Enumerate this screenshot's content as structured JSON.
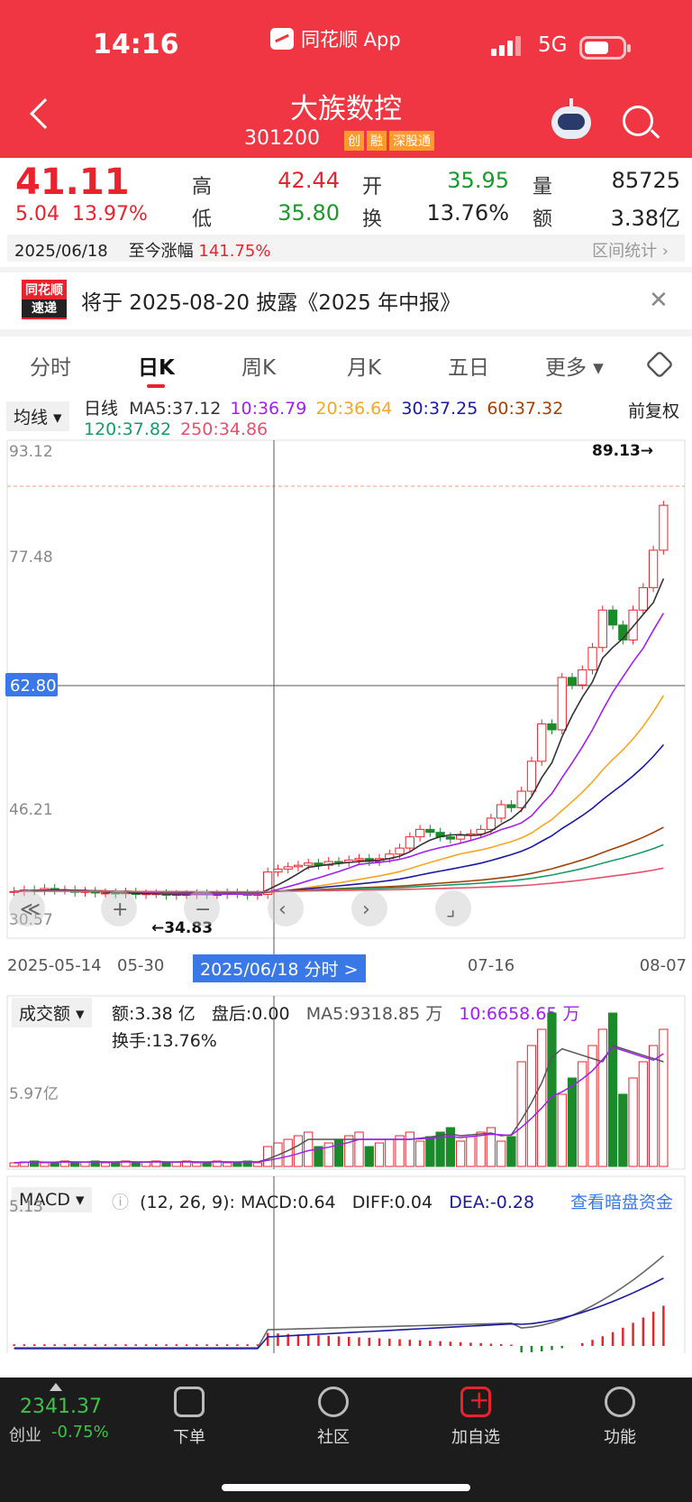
{
  "status": {
    "time": "14:16",
    "app": "同花顺 App",
    "network": "5G"
  },
  "stock": {
    "name": "大族数控",
    "code": "301200",
    "tags": [
      "创",
      "融",
      "深股通"
    ]
  },
  "quote": {
    "price": "41.11",
    "change": "5.04",
    "change_pct": "13.97%",
    "high_label": "高",
    "high": "42.44",
    "low_label": "低",
    "low": "35.80",
    "open_label": "开",
    "open": "35.95",
    "turnover_label": "换",
    "turnover": "13.76%",
    "volume_label": "量",
    "volume": "85725",
    "amount_label": "额",
    "amount": "3.38亿",
    "date": "2025/06/18",
    "since_label": "至今涨幅",
    "since_gain": "141.75%",
    "range_stat": "区间统计"
  },
  "notice": {
    "logo_top": "同花顺",
    "logo_bottom": "速递",
    "text": "将于 2025-08-20 披露《2025 年中报》"
  },
  "tabs": [
    "分时",
    "日K",
    "周K",
    "月K",
    "五日",
    "更多"
  ],
  "kline": {
    "indicator_select": "均线",
    "period": "日线",
    "adjust": "前复权",
    "ma": [
      {
        "label": "MA5:37.12",
        "color": "#333333"
      },
      {
        "label": "10:36.79",
        "color": "#a020f0"
      },
      {
        "label": "20:36.64",
        "color": "#f5a623"
      },
      {
        "label": "30:37.25",
        "color": "#1a1aa0"
      },
      {
        "label": "60:37.32",
        "color": "#a0420a"
      },
      {
        "label": "120:37.82",
        "color": "#1a9a6a"
      },
      {
        "label": "250:34.86",
        "color": "#e8506a"
      }
    ],
    "y_ticks": [
      "93.12",
      "77.48",
      "62.80",
      "46.21",
      "30.57"
    ],
    "crosshair_price": "62.80",
    "high_mark": "89.13→",
    "low_mark": "←34.83",
    "x_ticks": [
      "2025-05-14",
      "05-30",
      "07-16",
      "08-07"
    ],
    "crosshair_date": "2025/06/18 分时 >"
  },
  "volume": {
    "select": "成交额",
    "amount": "额:3.38 亿",
    "after_hours": "盘后:0.00",
    "ma5": "MA5:9318.85 万",
    "ma10": "10:6658.65 万",
    "turnover": "换手:13.76%",
    "y_tick": "5.97亿"
  },
  "macd": {
    "select": "MACD",
    "params": "(12, 26, 9):",
    "macd": "MACD:0.64",
    "diff": "DIFF:0.04",
    "dea": "DEA:-0.28",
    "link": "查看暗盘资金",
    "y_tick": "5.13"
  },
  "bottom": {
    "index_value": "2341.37",
    "index_name": "创业",
    "index_change": "-0.75%",
    "nav": [
      "下单",
      "社区",
      "加自选",
      "功能"
    ]
  }
}
